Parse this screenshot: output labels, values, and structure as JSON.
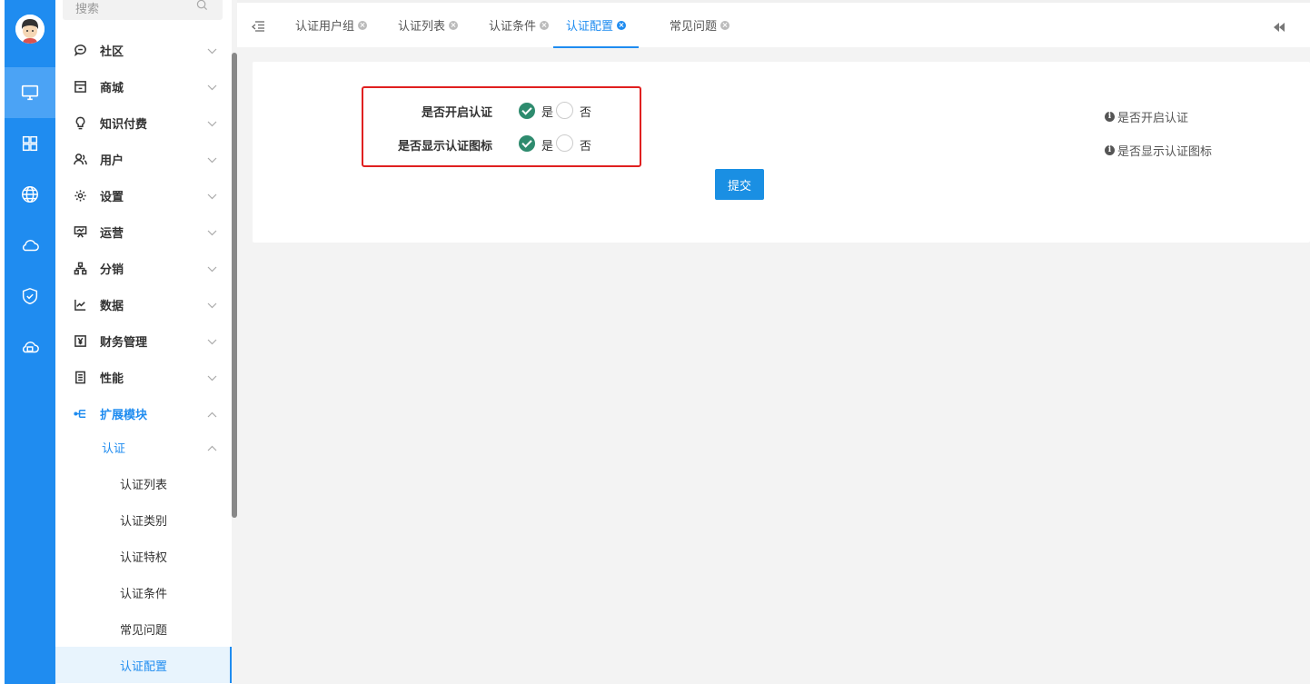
{
  "menu": {
    "search_placeholder": "搜索",
    "items": [
      {
        "label": "社区",
        "icon": "chat-icon"
      },
      {
        "label": "商城",
        "icon": "store-icon"
      },
      {
        "label": "知识付费",
        "icon": "lightbulb-icon"
      },
      {
        "label": "用户",
        "icon": "users-icon"
      },
      {
        "label": "设置",
        "icon": "gear-icon"
      },
      {
        "label": "运营",
        "icon": "presentation-icon"
      },
      {
        "label": "分销",
        "icon": "hierarchy-icon"
      },
      {
        "label": "数据",
        "icon": "line-chart-icon"
      },
      {
        "label": "财务管理",
        "icon": "yen-icon"
      },
      {
        "label": "性能",
        "icon": "server-icon"
      },
      {
        "label": "扩展模块",
        "icon": "extension-icon"
      }
    ],
    "sub_group": "认证",
    "leaves": [
      "认证列表",
      "认证类别",
      "认证特权",
      "认证条件",
      "常见问题",
      "认证配置"
    ]
  },
  "tabs": [
    "认证用户组",
    "认证列表",
    "认证条件",
    "认证配置",
    "常见问题"
  ],
  "form": {
    "fields": [
      {
        "label": "是否开启认证",
        "yes": "是",
        "no": "否",
        "value": "是"
      },
      {
        "label": "是否显示认证图标",
        "yes": "是",
        "no": "否",
        "value": "是"
      }
    ],
    "submit_label": "提交",
    "hints": [
      "是否开启认证",
      "是否显示认证图标"
    ]
  },
  "colors": {
    "rail": "#1f8cf0",
    "accent": "#1f8cf0",
    "radio_checked": "#2e8b6e",
    "highlight": "#e02020"
  }
}
